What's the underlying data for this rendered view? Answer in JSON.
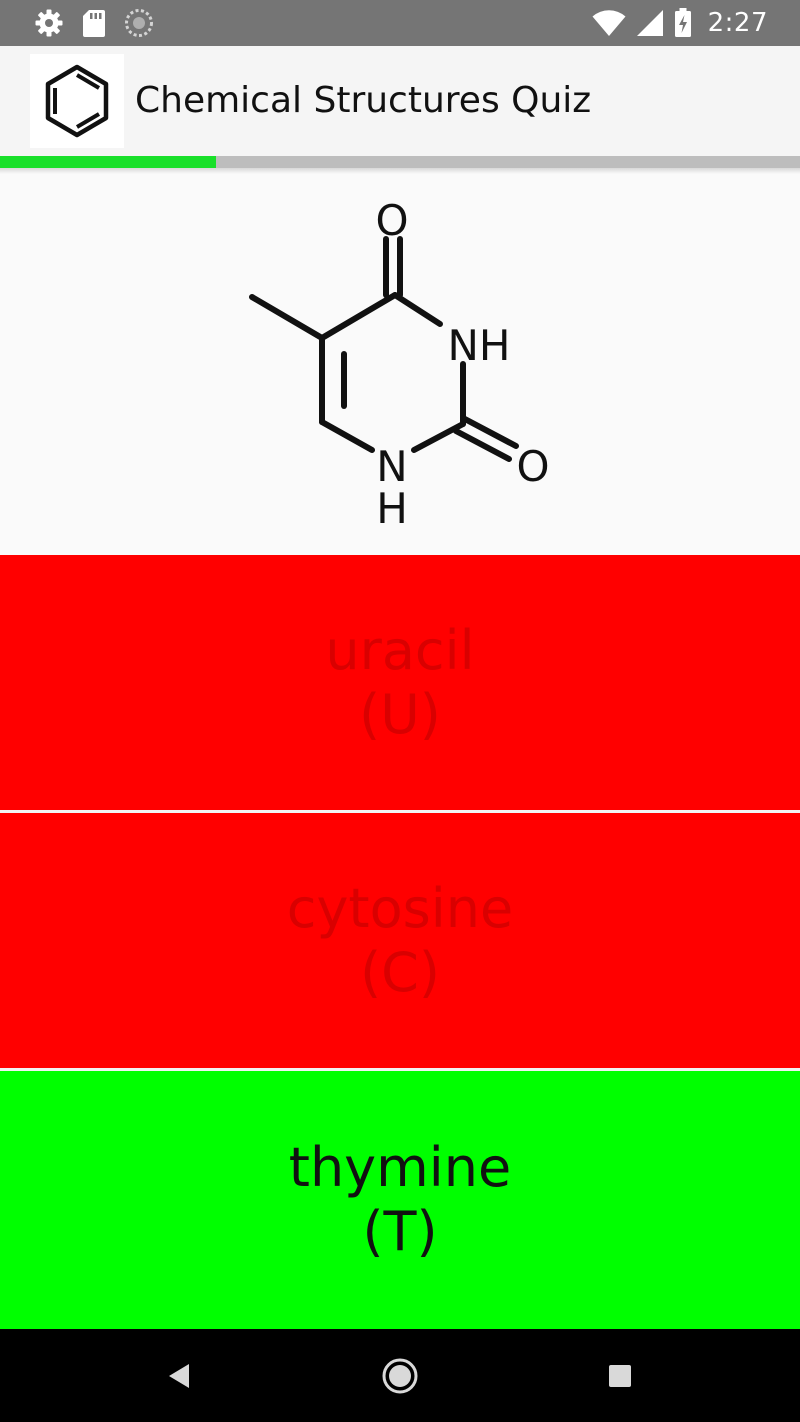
{
  "status_bar": {
    "time": "2:27",
    "icons": [
      "settings-icon",
      "sd-card-icon",
      "sync-icon",
      "wifi-icon",
      "cell-signal-icon",
      "battery-charging-icon"
    ]
  },
  "app_bar": {
    "title": "Chemical Structures Quiz",
    "logo_icon": "benzene-ring-icon"
  },
  "progress": {
    "fraction": 0.27,
    "color": "#19e02a"
  },
  "question": {
    "structure_icon": "thymine-structure",
    "atom_labels": {
      "top_oxygen": "O",
      "nh_right": "NH",
      "oxygen_right": "O",
      "n_bottom": "N",
      "h_bottom": "H"
    }
  },
  "answers": [
    {
      "name": "uracil",
      "abbr": "(U)",
      "state": "wrong",
      "color": "#ff0000"
    },
    {
      "name": "cytosine",
      "abbr": "(C)",
      "state": "wrong",
      "color": "#ff0000"
    },
    {
      "name": "thymine",
      "abbr": "(T)",
      "state": "correct",
      "color": "#00ff00"
    }
  ],
  "nav_bar": {
    "icons": [
      "back-icon",
      "home-icon",
      "recents-icon"
    ]
  }
}
